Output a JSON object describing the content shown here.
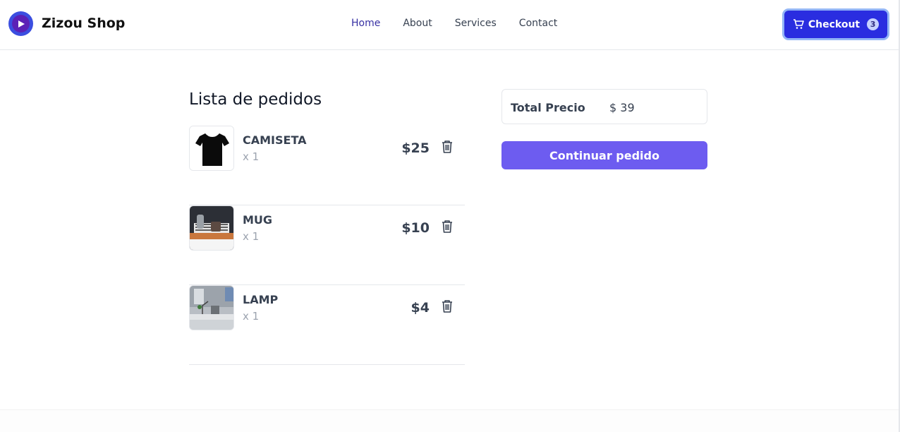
{
  "header": {
    "brand": "Zizou Shop",
    "nav": [
      {
        "label": "Home",
        "active": true
      },
      {
        "label": "About",
        "active": false
      },
      {
        "label": "Services",
        "active": false
      },
      {
        "label": "Contact",
        "active": false
      }
    ],
    "checkout_label": "Checkout",
    "checkout_count": "3",
    "checkout_icon": "cart-icon"
  },
  "orders": {
    "title": "Lista de pedidos",
    "items": [
      {
        "name": "CAMISETA",
        "qty": "x 1",
        "price": "$25",
        "image": "t-shirt"
      },
      {
        "name": "MUG",
        "qty": "x 1",
        "price": "$10",
        "image": "mug"
      },
      {
        "name": "LAMP",
        "qty": "x 1",
        "price": "$4",
        "image": "lamp"
      }
    ],
    "delete_icon": "trash-icon"
  },
  "summary": {
    "total_label": "Total Precio",
    "total_value": "$ 39",
    "continue_label": "Continuar pedido"
  },
  "colors": {
    "accent": "#2a2de0",
    "button": "#6d5cf0",
    "active_nav": "#3730a3"
  }
}
